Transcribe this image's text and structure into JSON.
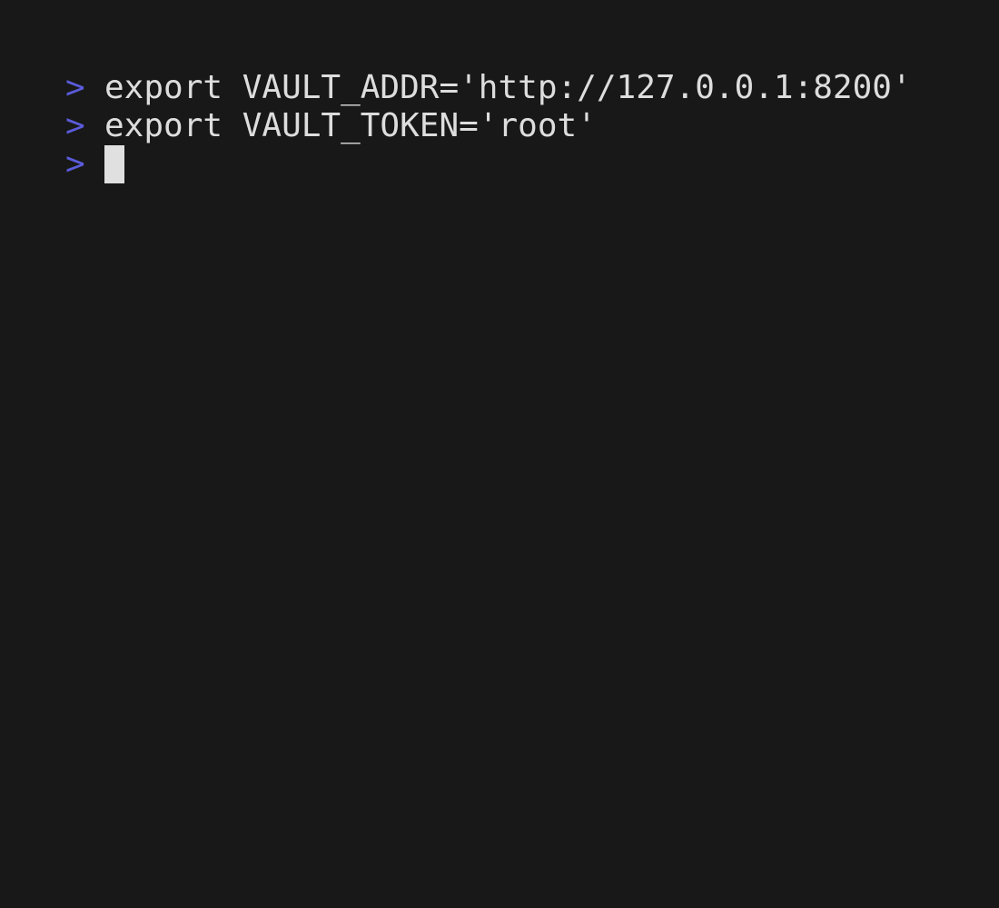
{
  "terminal": {
    "prompt_symbol": ">",
    "lines": [
      {
        "prompt": ">",
        "command": "export VAULT_ADDR='http://127.0.0.1:8200'"
      },
      {
        "prompt": ">",
        "command": "export VAULT_TOKEN='root'"
      },
      {
        "prompt": ">",
        "command": ""
      }
    ],
    "colors": {
      "background": "#181818",
      "prompt": "#5b5bdc",
      "text": "#dddddd",
      "cursor": "#e0e0e0"
    }
  }
}
